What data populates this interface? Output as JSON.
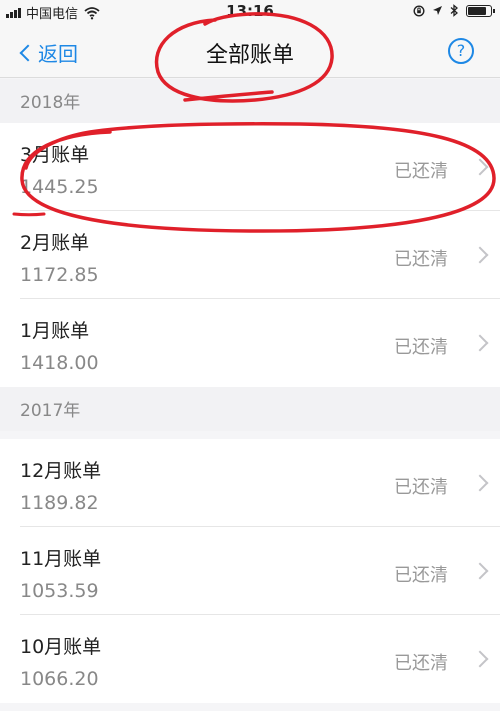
{
  "status_bar": {
    "carrier": "中国电信",
    "time": "13:16",
    "battery_level": 0.85
  },
  "nav": {
    "back_label": "返回",
    "title": "全部账单",
    "help_symbol": "?"
  },
  "sections": [
    {
      "year": "2018年",
      "bills": [
        {
          "title": "3月账单",
          "amount": "1445.25",
          "status": "已还清"
        },
        {
          "title": "2月账单",
          "amount": "1172.85",
          "status": "已还清"
        },
        {
          "title": "1月账单",
          "amount": "1418.00",
          "status": "已还清"
        }
      ]
    },
    {
      "year": "2017年",
      "bills": [
        {
          "title": "12月账单",
          "amount": "1189.82",
          "status": "已还清"
        },
        {
          "title": "11月账单",
          "amount": "1053.59",
          "status": "已还清"
        },
        {
          "title": "10月账单",
          "amount": "1066.20",
          "status": "已还清"
        }
      ]
    }
  ],
  "colors": {
    "accent": "#1e88e5",
    "annotation": "#e0202a"
  },
  "icons": [
    "signal-icon",
    "wifi-icon",
    "lock-rotation-icon",
    "location-icon",
    "bluetooth-icon",
    "battery-icon",
    "back-chevron-icon",
    "help-icon",
    "chevron-right-icon"
  ]
}
